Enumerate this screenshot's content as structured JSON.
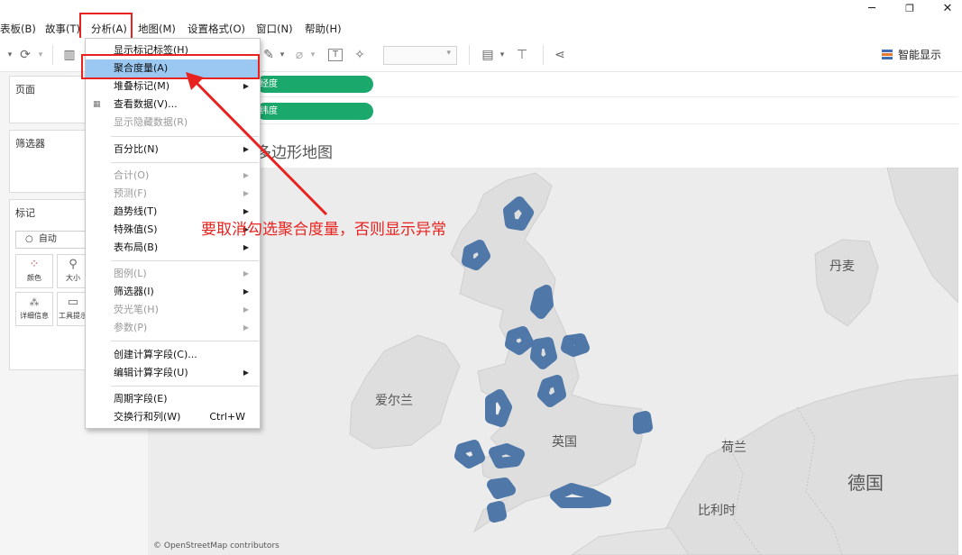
{
  "window": {
    "minimize_icon": "minimize-icon",
    "maximize_icon": "restore-icon",
    "close_icon": "close-icon"
  },
  "menubar": {
    "items": [
      {
        "label": "表板(B)"
      },
      {
        "label": "故事(T)"
      },
      {
        "label": "分析(A)"
      },
      {
        "label": "地图(M)"
      },
      {
        "label": "设置格式(O)"
      },
      {
        "label": "窗口(N)"
      },
      {
        "label": "帮助(H)"
      }
    ]
  },
  "toolbar": {
    "smart_show_label": "智能显示"
  },
  "panels": {
    "pages_title": "页面",
    "filters_title": "筛选器",
    "marks_title": "标记",
    "marks_type": "自动",
    "mark_buttons": [
      {
        "label": "颜色"
      },
      {
        "label": "大小"
      },
      {
        "label": "详细信息"
      },
      {
        "label": "工具提示"
      }
    ]
  },
  "shelves": {
    "columns_pill": "经度",
    "rows_pill": "纬度"
  },
  "sheet": {
    "title": "多边形地图",
    "osm_credit": "© OpenStreetMap contributors",
    "labels": {
      "uk": "英国",
      "ireland": "爱尔兰",
      "denmark": "丹麦",
      "netherlands": "荷兰",
      "germany": "德国",
      "belgium": "比利时"
    }
  },
  "dropdown_menu": {
    "items": [
      {
        "label": "显示标记标签(H)"
      },
      {
        "label": "聚合度量(A)"
      },
      {
        "label": "堆叠标记(M)"
      },
      {
        "label": "查看数据(V)..."
      },
      {
        "label": "显示隐藏数据(R)"
      },
      {
        "label": "百分比(N)"
      },
      {
        "label": "合计(O)"
      },
      {
        "label": "预测(F)"
      },
      {
        "label": "趋势线(T)"
      },
      {
        "label": "特殊值(S)"
      },
      {
        "label": "表布局(B)"
      },
      {
        "label": "图例(L)"
      },
      {
        "label": "筛选器(I)"
      },
      {
        "label": "荧光笔(H)"
      },
      {
        "label": "参数(P)"
      },
      {
        "label": "创建计算字段(C)..."
      },
      {
        "label": "编辑计算字段(U)"
      },
      {
        "label": "周期字段(E)"
      },
      {
        "label": "交换行和列(W)",
        "shortcut": "Ctrl+W"
      }
    ]
  },
  "annotation": {
    "text": "要取消勾选聚合度量，否则显示异常",
    "color": "#e8221e"
  },
  "colors": {
    "pill": "#1aa86c",
    "highlight": "#9ac8f2",
    "region_fill": "#4f78a8",
    "annotation": "#e8221e"
  }
}
